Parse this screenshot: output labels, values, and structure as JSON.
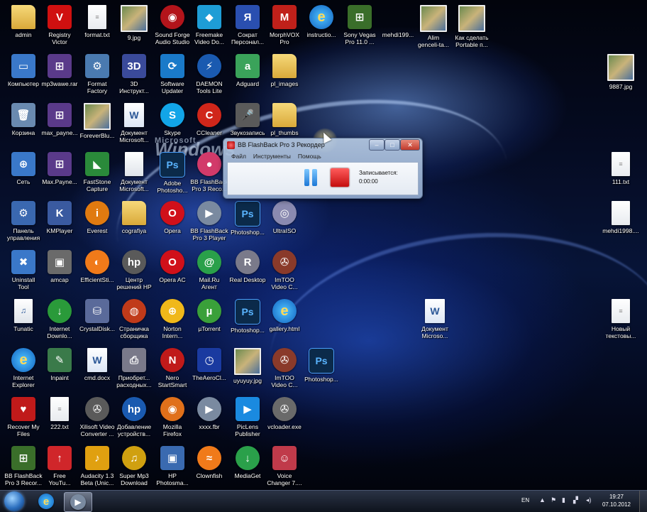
{
  "desktop": {
    "logo_line1": "Microsoft",
    "logo_line2": "Windows",
    "icons": [
      {
        "label": "admin",
        "icon": "user-folder-icon",
        "style": "g-folder",
        "glyph": "",
        "color": ""
      },
      {
        "label": "Registry\nVictor",
        "icon": "registry-icon",
        "style": "g-exe",
        "glyph": "V",
        "color": "#d01010"
      },
      {
        "label": "format.txt",
        "icon": "text-file-icon",
        "style": "g-txt",
        "glyph": "≡",
        "color": ""
      },
      {
        "label": "9.jpg",
        "icon": "image-file-icon",
        "style": "g-img",
        "glyph": "",
        "color": ""
      },
      {
        "label": "Sound Forge\nAudio Studio",
        "icon": "sound-forge-icon",
        "style": "g-round",
        "glyph": "◉",
        "color": "#b3141b"
      },
      {
        "label": "Freemake\nVideo Do...",
        "icon": "freemake-icon",
        "style": "g-exe",
        "glyph": "◆",
        "color": "#1e9dd6"
      },
      {
        "label": "Сократ\nПерсонал...",
        "icon": "sokrat-icon",
        "style": "g-exe",
        "glyph": "Я",
        "color": "#2a4fb0"
      },
      {
        "label": "MorphVOX\nPro",
        "icon": "morphvox-icon",
        "style": "g-exe",
        "glyph": "M",
        "color": "#c0201a"
      },
      {
        "label": "instructio...",
        "icon": "html-file-icon",
        "style": "g-ie",
        "glyph": "e",
        "color": ""
      },
      {
        "label": "Sony Vegas\nPro 11.0 ...",
        "icon": "sony-vegas-icon",
        "style": "g-exe",
        "glyph": "⊞",
        "color": "#3a6e2a"
      },
      {
        "label": "mehdi199...",
        "icon": "blank-file-icon",
        "style": "",
        "glyph": "",
        "color": ""
      },
      {
        "label": "Alim\ngenceli-ta...",
        "icon": "video-thumbnail-icon",
        "style": "g-img",
        "glyph": "",
        "color": ""
      },
      {
        "label": "Как сделать\nPortable п...",
        "icon": "portable-icon",
        "style": "g-img",
        "glyph": "",
        "color": ""
      },
      {
        "label": "Компьютер",
        "icon": "computer-icon",
        "style": "g-exe",
        "glyph": "▭",
        "color": "#3a78c9"
      },
      {
        "label": "mp3wawe.rar",
        "icon": "rar-archive-icon",
        "style": "g-exe",
        "glyph": "⊞",
        "color": "#5a3a8a"
      },
      {
        "label": "Format\nFactory",
        "icon": "format-factory-icon",
        "style": "g-exe",
        "glyph": "⚙",
        "color": "#4a7ab0"
      },
      {
        "label": "3D\nИнструкт...",
        "icon": "3d-instructor-icon",
        "style": "g-exe",
        "glyph": "3D",
        "color": "#3a4a9a"
      },
      {
        "label": "Software\nUpdater",
        "icon": "software-updater-icon",
        "style": "g-exe",
        "glyph": "⟳",
        "color": "#1a7ac9"
      },
      {
        "label": "DAEMON\nTools Lite",
        "icon": "daemon-tools-icon",
        "style": "g-round",
        "glyph": "⚡",
        "color": "#1a5ab0"
      },
      {
        "label": "Adguard",
        "icon": "adguard-icon",
        "style": "g-exe",
        "glyph": "a",
        "color": "#3aa35a"
      },
      {
        "label": "pl_images",
        "icon": "folder-icon",
        "style": "g-folder",
        "glyph": "",
        "color": ""
      },
      {
        "label": "9887.jpg",
        "icon": "image-file-icon",
        "style": "g-img",
        "glyph": "",
        "color": ""
      },
      {
        "label": "Корзина",
        "icon": "recycle-bin-icon",
        "style": "g-exe",
        "glyph": "🗑",
        "color": "#6a8ab0"
      },
      {
        "label": "max_payne...",
        "icon": "rar-archive-icon",
        "style": "g-exe",
        "glyph": "⊞",
        "color": "#5a3a8a"
      },
      {
        "label": "ForeverBlu...",
        "icon": "wallpaper-file-icon",
        "style": "g-img",
        "glyph": "",
        "color": ""
      },
      {
        "label": "Документ\nMicrosoft...",
        "icon": "word-document-icon",
        "style": "g-word",
        "glyph": "W",
        "color": ""
      },
      {
        "label": "Skype",
        "icon": "skype-icon",
        "style": "g-round",
        "glyph": "S",
        "color": "#12a5e8"
      },
      {
        "label": "CCleaner",
        "icon": "ccleaner-icon",
        "style": "g-round",
        "glyph": "C",
        "color": "#d0261a"
      },
      {
        "label": "Звукозапись",
        "icon": "microphone-icon",
        "style": "g-exe",
        "glyph": "🎤",
        "color": "#5a5a5a"
      },
      {
        "label": "pl_thumbs",
        "icon": "folder-icon",
        "style": "g-folder",
        "glyph": "",
        "color": ""
      },
      {
        "label": "Сеть",
        "icon": "network-icon",
        "style": "g-exe",
        "glyph": "⊕",
        "color": "#3a78c9"
      },
      {
        "label": "Max.Payne...",
        "icon": "rar-archive-icon",
        "style": "g-exe",
        "glyph": "⊞",
        "color": "#5a3a8a"
      },
      {
        "label": "FastStone\nCapture",
        "icon": "faststone-icon",
        "style": "g-exe",
        "glyph": "◣",
        "color": "#2a8a3a"
      },
      {
        "label": "Документ\nMicrosoft...",
        "icon": "blank-document-icon",
        "style": "g-doc",
        "glyph": "",
        "color": ""
      },
      {
        "label": "Adobe\nPhotosho...",
        "icon": "photoshop-icon",
        "style": "g-ps",
        "glyph": "Ps",
        "color": ""
      },
      {
        "label": "BB FlashBack\nPro 3 Reco...",
        "icon": "flashback-recorder-icon",
        "style": "g-round",
        "glyph": "●",
        "color": "#d23a6a"
      },
      {
        "label": "111.txt",
        "icon": "text-file-icon",
        "style": "g-txt",
        "glyph": "≡",
        "color": ""
      },
      {
        "label": "Панель\nуправления",
        "icon": "control-panel-icon",
        "style": "g-exe",
        "glyph": "⚙",
        "color": "#3a68b0"
      },
      {
        "label": "KMPlayer",
        "icon": "kmplayer-icon",
        "style": "g-exe",
        "glyph": "K",
        "color": "#3a5aa0"
      },
      {
        "label": "Everest",
        "icon": "everest-icon",
        "style": "g-round",
        "glyph": "i",
        "color": "#e07a10"
      },
      {
        "label": "cografiya",
        "icon": "folder-icon",
        "style": "g-folder",
        "glyph": "",
        "color": ""
      },
      {
        "label": "Opera",
        "icon": "opera-icon",
        "style": "g-round",
        "glyph": "O",
        "color": "#d0101a"
      },
      {
        "label": "BB FlashBack\nPro 3 Player",
        "icon": "flashback-player-icon",
        "style": "g-round",
        "glyph": "▶",
        "color": "#7a8aa0"
      },
      {
        "label": "Photoshop...",
        "icon": "photoshop-icon",
        "style": "g-ps",
        "glyph": "Ps",
        "color": ""
      },
      {
        "label": "UltraISO",
        "icon": "ultraiso-icon",
        "style": "g-round",
        "glyph": "◎",
        "color": "#8a8ab0"
      },
      {
        "label": "mehdi1998....",
        "icon": "blank-file-icon",
        "style": "g-txt",
        "glyph": "",
        "color": ""
      },
      {
        "label": "Uninstall\nTool",
        "icon": "uninstall-tool-icon",
        "style": "g-exe",
        "glyph": "✖",
        "color": "#3a78c9"
      },
      {
        "label": "amcap",
        "icon": "amcap-icon",
        "style": "g-exe",
        "glyph": "▣",
        "color": "#6a6a6a"
      },
      {
        "label": "EfficientSti...",
        "icon": "efficient-icon",
        "style": "g-round",
        "glyph": "◐",
        "color": "#f07a1a"
      },
      {
        "label": "Центр\nрешений HP",
        "icon": "hp-center-icon",
        "style": "g-round",
        "glyph": "hp",
        "color": "#5a5a5a"
      },
      {
        "label": "Opera AC",
        "icon": "opera-ac-icon",
        "style": "g-round",
        "glyph": "O",
        "color": "#d0101a"
      },
      {
        "label": "Mail.Ru\nАгент",
        "icon": "mailru-agent-icon",
        "style": "g-round",
        "glyph": "@",
        "color": "#2aa04a"
      },
      {
        "label": "Real Desktop",
        "icon": "real-desktop-icon",
        "style": "g-round",
        "glyph": "R",
        "color": "#7a7a8a"
      },
      {
        "label": "ImTOO\nVideo C...",
        "icon": "imtoo-video-icon",
        "style": "g-round",
        "glyph": "✇",
        "color": "#8a3a2a"
      },
      {
        "label": "Tunatic",
        "icon": "tunatic-icon",
        "style": "g-doc",
        "glyph": "♫",
        "color": ""
      },
      {
        "label": "Internet\nDownlo...",
        "icon": "internet-download-icon",
        "style": "g-round",
        "glyph": "↓",
        "color": "#2a9a3a"
      },
      {
        "label": "CrystalDisk...",
        "icon": "crystaldisk-icon",
        "style": "g-exe",
        "glyph": "⛁",
        "color": "#5a6a9a"
      },
      {
        "label": "Страничка\nсборщика",
        "icon": "browser-page-icon",
        "style": "g-round",
        "glyph": "◍",
        "color": "#c03a1a"
      },
      {
        "label": "Norton\nIntern...",
        "icon": "norton-icon",
        "style": "g-round",
        "glyph": "⊕",
        "color": "#f0b81a"
      },
      {
        "label": "µTorrent",
        "icon": "utorrent-icon",
        "style": "g-round",
        "glyph": "µ",
        "color": "#3aa03a"
      },
      {
        "label": "Photoshop...",
        "icon": "photoshop-icon",
        "style": "g-ps",
        "glyph": "Ps",
        "color": ""
      },
      {
        "label": "gallery.html",
        "icon": "html-file-icon",
        "style": "g-ie",
        "glyph": "e",
        "color": ""
      },
      {
        "label": "Документ\nMicroso...",
        "icon": "word-document-icon",
        "style": "g-word",
        "glyph": "W",
        "color": ""
      },
      {
        "label": "Новый\nтекстовы...",
        "icon": "text-file-icon",
        "style": "g-txt",
        "glyph": "≡",
        "color": ""
      },
      {
        "label": "Internet\nExplorer",
        "icon": "internet-explorer-icon",
        "style": "g-ie",
        "glyph": "e",
        "color": ""
      },
      {
        "label": "Inpaint",
        "icon": "inpaint-icon",
        "style": "g-exe",
        "glyph": "✎",
        "color": "#3a7a4a"
      },
      {
        "label": "cmd.docx",
        "icon": "word-document-icon",
        "style": "g-word",
        "glyph": "W",
        "color": ""
      },
      {
        "label": "Приобрет...\nрасходных...",
        "icon": "printer-icon",
        "style": "g-exe",
        "glyph": "⎙",
        "color": "#7a7a8a"
      },
      {
        "label": "Nero\nStartSmart",
        "icon": "nero-icon",
        "style": "g-round",
        "glyph": "N",
        "color": "#c01a1a"
      },
      {
        "label": "TheAeroCl...",
        "icon": "aero-clock-icon",
        "style": "g-exe",
        "glyph": "◷",
        "color": "#1a3aa0"
      },
      {
        "label": "uyuyuy.jpg",
        "icon": "image-file-icon",
        "style": "g-img",
        "glyph": "",
        "color": ""
      },
      {
        "label": "ImTOO\nVideo C...",
        "icon": "imtoo-video-icon",
        "style": "g-round",
        "glyph": "✇",
        "color": "#8a3a2a"
      },
      {
        "label": "Photoshop...",
        "icon": "photoshop-icon",
        "style": "g-ps",
        "glyph": "Ps",
        "color": ""
      },
      {
        "label": "Recover My\nFiles",
        "icon": "recover-files-icon",
        "style": "g-exe",
        "glyph": "♥",
        "color": "#c01a1a"
      },
      {
        "label": "222.txt",
        "icon": "text-file-icon",
        "style": "g-txt",
        "glyph": "≡",
        "color": ""
      },
      {
        "label": "Xilisoft Video\nConverter ...",
        "icon": "xilisoft-icon",
        "style": "g-round",
        "glyph": "✇",
        "color": "#5a5a5a"
      },
      {
        "label": "Добавление\nустройств...",
        "icon": "hp-add-device-icon",
        "style": "g-round",
        "glyph": "hp",
        "color": "#1a5ab0"
      },
      {
        "label": "Mozilla\nFirefox",
        "icon": "firefox-icon",
        "style": "g-round",
        "glyph": "◉",
        "color": "#e0701a"
      },
      {
        "label": "xxxx.fbr",
        "icon": "flashback-file-icon",
        "style": "g-round",
        "glyph": "▶",
        "color": "#7a8aa0"
      },
      {
        "label": "PicLens\nPublisher",
        "icon": "piclens-icon",
        "style": "g-exe",
        "glyph": "▶",
        "color": "#1a8ae0"
      },
      {
        "label": "vcloader.exe",
        "icon": "vcloader-icon",
        "style": "g-round",
        "glyph": "✇",
        "color": "#6a6a6a"
      },
      {
        "label": "BB FlashBack\nPro 3 Recor...",
        "icon": "flashback-recorder-icon",
        "style": "g-exe",
        "glyph": "⊞",
        "color": "#3a6e2a"
      },
      {
        "label": "Free\nYouTu...",
        "icon": "free-youtube-icon",
        "style": "g-exe",
        "glyph": "↑",
        "color": "#d0262a"
      },
      {
        "label": "Audacity 1.3\nBeta (Unic...",
        "icon": "audacity-icon",
        "style": "g-exe",
        "glyph": "♪",
        "color": "#e0a010"
      },
      {
        "label": "Super Mp3\nDownload",
        "icon": "mp3-download-icon",
        "style": "g-round",
        "glyph": "♫",
        "color": "#d0a010"
      },
      {
        "label": "HP\nPhotosma...",
        "icon": "hp-photosmart-icon",
        "style": "g-exe",
        "glyph": "▣",
        "color": "#3a6ab0"
      },
      {
        "label": "Clownfish",
        "icon": "clownfish-icon",
        "style": "g-round",
        "glyph": "≈",
        "color": "#f07a1a"
      },
      {
        "label": "MediaGet",
        "icon": "mediaget-icon",
        "style": "g-round",
        "glyph": "↓",
        "color": "#2aa04a"
      },
      {
        "label": "Voice\nChanger 7....",
        "icon": "voice-changer-icon",
        "style": "g-exe",
        "glyph": "☺",
        "color": "#c03a4a"
      }
    ]
  },
  "recorder": {
    "title": "BB FlashBack Pro 3 Рекордер",
    "menu": [
      "Файл",
      "Инструменты",
      "Помощь"
    ],
    "status": "Записывается:",
    "time": "0:00:00",
    "min_label": "–",
    "max_label": "□",
    "close_label": "✕"
  },
  "taskbar": {
    "lang": "EN",
    "tray_up": "▲",
    "time": "19:27",
    "date": "07.10.2012"
  }
}
